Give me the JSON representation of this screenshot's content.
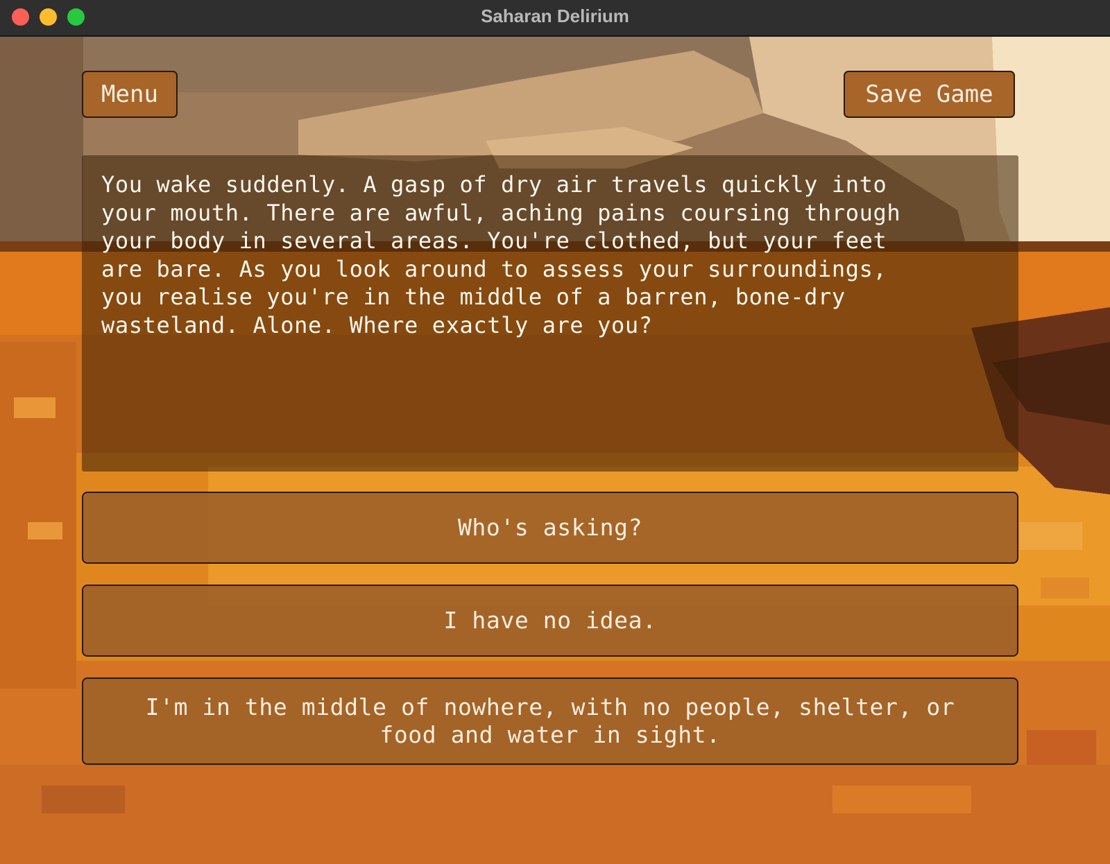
{
  "window": {
    "title": "Saharan Delirium"
  },
  "toolbar": {
    "menu_label": "Menu",
    "save_label": "Save Game"
  },
  "story": {
    "narrative": "You wake suddenly. A gasp of dry air travels quickly into\nyour mouth. There are awful, aching pains coursing through\nyour body in several areas. You're clothed, but your feet\nare bare. As you look around to assess your surroundings,\nyou realise you're in the middle of a barren, bone-dry\nwasteland. Alone. Where exactly are you?"
  },
  "choices": [
    {
      "label": "Who's asking?"
    },
    {
      "label": "I have no idea."
    },
    {
      "label": "I'm in the middle of nowhere, with no people, shelter, or food and water in sight."
    }
  ],
  "colors": {
    "sand": "#d06f22",
    "sky": "#c9a57a",
    "button": "#a7652a",
    "text": "#fbeee0"
  }
}
